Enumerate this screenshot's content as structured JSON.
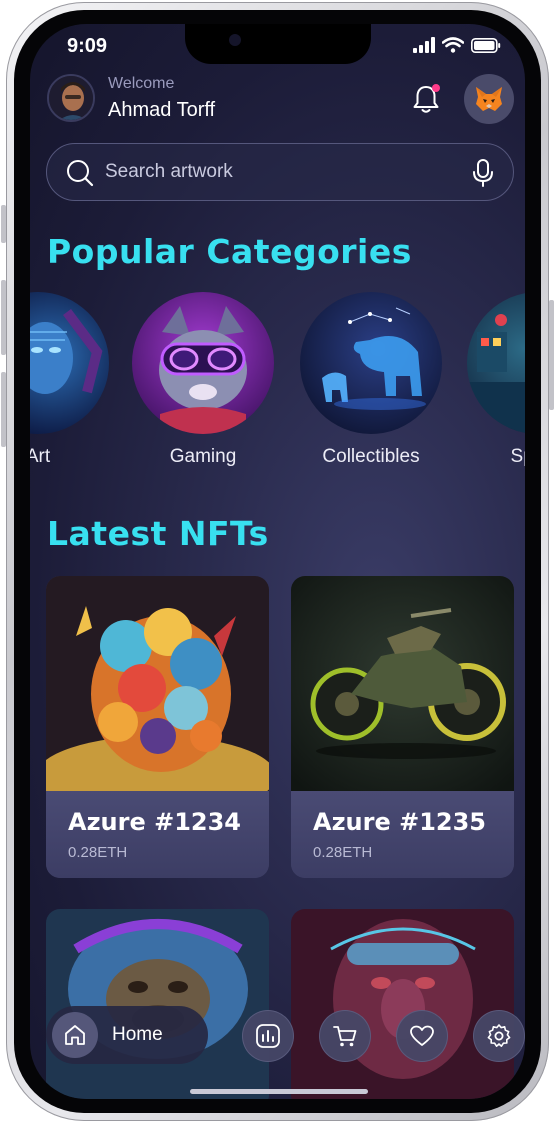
{
  "status_bar": {
    "time": "9:09"
  },
  "header": {
    "welcome": "Welcome",
    "username": "Ahmad Torff"
  },
  "search": {
    "placeholder": "Search artwork"
  },
  "popular": {
    "title": "Popular Categories",
    "categories": [
      {
        "label": "Art"
      },
      {
        "label": "Gaming"
      },
      {
        "label": "Collectibles"
      },
      {
        "label": "Sports"
      }
    ]
  },
  "latest": {
    "title": "Latest NFTs",
    "items": [
      {
        "name": "Azure #1234",
        "price": "0.28ETH"
      },
      {
        "name": "Azure #1235",
        "price": "0.28ETH"
      }
    ]
  },
  "nav": {
    "home_label": "Home"
  },
  "colors": {
    "accent": "#38e0f0",
    "background": "#1c1c38",
    "notification": "#ff3b8a"
  }
}
